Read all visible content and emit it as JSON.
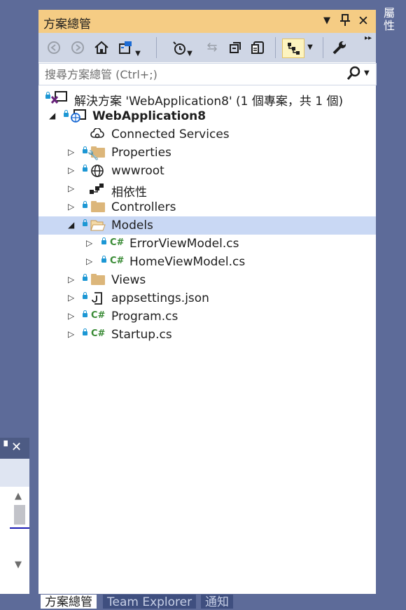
{
  "panel": {
    "title": "方案總管",
    "title_icons": [
      "dropdown-icon",
      "pin-icon",
      "close-icon"
    ],
    "toolbar_icons": [
      "back-icon",
      "forward-icon",
      "home-icon",
      "switch-views-icon",
      "pending-changes-icon",
      "sync-icon",
      "collapse-all-icon",
      "show-all-files-icon",
      "preview-selected-icon",
      "properties-icon"
    ],
    "search_placeholder": "搜尋方案總管 (Ctrl+;)"
  },
  "tree": {
    "solution": "解決方案 'WebApplication8' (1 個專案，共 1 個)",
    "project": "WebApplication8",
    "items": [
      {
        "label": "Connected Services"
      },
      {
        "label": "Properties"
      },
      {
        "label": "wwwroot"
      },
      {
        "label": "相依性"
      },
      {
        "label": "Controllers"
      },
      {
        "label": "Models"
      },
      {
        "label": "ErrorViewModel.cs"
      },
      {
        "label": "HomeViewModel.cs"
      },
      {
        "label": "Views"
      },
      {
        "label": "appsettings.json"
      },
      {
        "label": "Program.cs"
      },
      {
        "label": "Startup.cs"
      }
    ],
    "cs_badge": "C#"
  },
  "bottom_tabs": [
    "方案總管",
    "Team Explorer",
    "通知"
  ],
  "right_tab": "屬性",
  "colors": {
    "title_bg": "#f5cc84",
    "selected_row": "#c9d8f4",
    "window_bg": "#5d6b99"
  }
}
